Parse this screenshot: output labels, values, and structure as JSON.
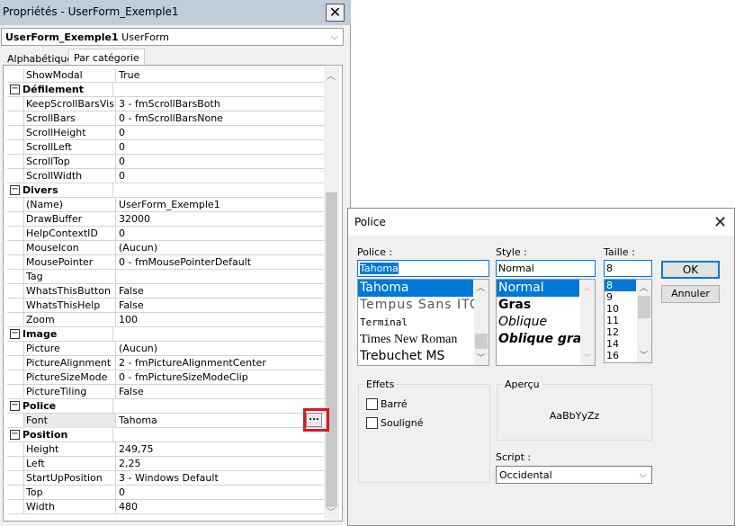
{
  "panel": {
    "title": "Propriétés - UserForm_Exemple1",
    "object_name": "UserForm_Exemple1",
    "object_type": "UserForm",
    "tabs": [
      {
        "label": "Alphabétique"
      },
      {
        "label": "Par catégorie",
        "active": true
      }
    ],
    "rows": [
      {
        "name": "ShowModal",
        "value": "True"
      },
      {
        "category": true,
        "name": "Défilement"
      },
      {
        "name": "KeepScrollBarsVisible",
        "value": "3 - fmScrollBarsBoth"
      },
      {
        "name": "ScrollBars",
        "value": "0 - fmScrollBarsNone"
      },
      {
        "name": "ScrollHeight",
        "value": "0"
      },
      {
        "name": "ScrollLeft",
        "value": "0"
      },
      {
        "name": "ScrollTop",
        "value": "0"
      },
      {
        "name": "ScrollWidth",
        "value": "0"
      },
      {
        "category": true,
        "name": "Divers"
      },
      {
        "name": "(Name)",
        "value": "UserForm_Exemple1"
      },
      {
        "name": "DrawBuffer",
        "value": "32000"
      },
      {
        "name": "HelpContextID",
        "value": "0"
      },
      {
        "name": "MouseIcon",
        "value": "(Aucun)"
      },
      {
        "name": "MousePointer",
        "value": "0 - fmMousePointerDefault"
      },
      {
        "name": "Tag",
        "value": ""
      },
      {
        "name": "WhatsThisButton",
        "value": "False"
      },
      {
        "name": "WhatsThisHelp",
        "value": "False"
      },
      {
        "name": "Zoom",
        "value": "100"
      },
      {
        "category": true,
        "name": "Image"
      },
      {
        "name": "Picture",
        "value": "(Aucun)"
      },
      {
        "name": "PictureAlignment",
        "value": "2 - fmPictureAlignmentCenter"
      },
      {
        "name": "PictureSizeMode",
        "value": "0 - fmPictureSizeModeClip"
      },
      {
        "name": "PictureTiling",
        "value": "False"
      },
      {
        "category": true,
        "name": "Police"
      },
      {
        "name": "Font",
        "value": "Tahoma",
        "selected": true
      },
      {
        "category": true,
        "name": "Position"
      },
      {
        "name": "Height",
        "value": "249,75"
      },
      {
        "name": "Left",
        "value": "2,25"
      },
      {
        "name": "StartUpPosition",
        "value": "3 - Windows Default"
      },
      {
        "name": "Top",
        "value": "0"
      },
      {
        "name": "Width",
        "value": "480"
      }
    ],
    "ellipsis_label": "...",
    "highlight_color": "#e0141e"
  },
  "dialog": {
    "title": "Police",
    "font": {
      "label": "Police :",
      "value": "Tahoma",
      "items": [
        "Tahoma",
        "Tempus Sans ITC",
        "Terminal",
        "Times New Roman",
        "Trebuchet MS"
      ]
    },
    "style": {
      "label": "Style :",
      "value": "Normal",
      "items": [
        "Normal",
        "Gras",
        "Oblique",
        "Oblique gras"
      ]
    },
    "size": {
      "label": "Taille :",
      "value": "8",
      "items": [
        "8",
        "9",
        "10",
        "11",
        "12",
        "14",
        "16"
      ]
    },
    "ok_label": "OK",
    "cancel_label": "Annuler",
    "effects": {
      "label": "Effets",
      "strike": "Barré",
      "underline": "Souligné"
    },
    "preview": {
      "label": "Aperçu",
      "text": "AaBbYyZz"
    },
    "script": {
      "label": "Script :",
      "value": "Occidental"
    },
    "accent": "#0078d7"
  }
}
